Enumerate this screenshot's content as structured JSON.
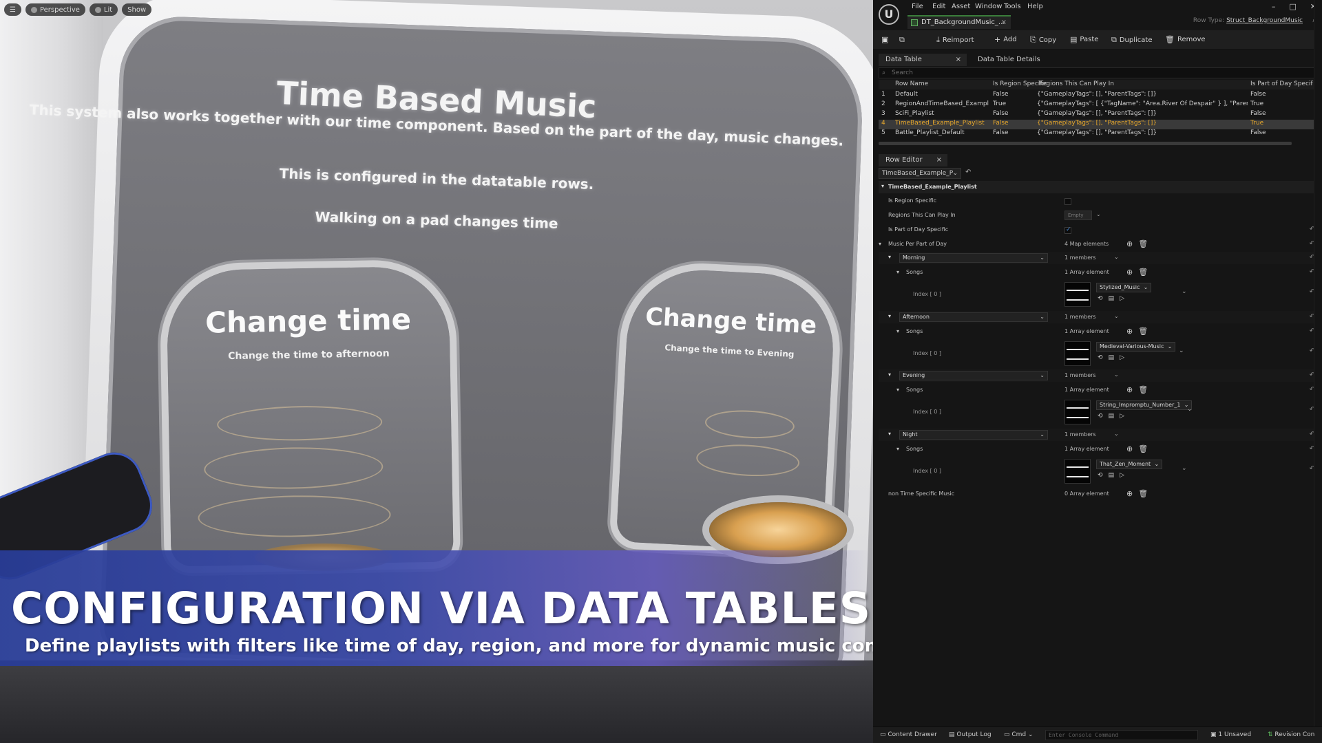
{
  "viewport": {
    "toolbar": {
      "perspective": "Perspective",
      "lit": "Lit",
      "show": "Show"
    },
    "title": "Time Based Music",
    "line1": "This system also works together with our time component. Based on the part of the day, music changes.",
    "line2": "This is configured in the datatable rows.",
    "line3": "Walking on a pad changes time",
    "padA": {
      "title": "Change time",
      "subtitle": "Change the time to afternoon"
    },
    "padB": {
      "title": "Change time",
      "subtitle": "Change the time to Evening"
    }
  },
  "banner": {
    "title": "CONFIGURATION VIA DATA TABLES",
    "subtitle": "Define playlists with filters like time of day, region, and more for dynamic music control"
  },
  "editor": {
    "menu": [
      "File",
      "Edit",
      "Asset",
      "Window",
      "Tools",
      "Help"
    ],
    "logo": "U",
    "window_controls": {
      "minimize": "–",
      "maximize": "□",
      "close": "✕"
    },
    "doc_tab": {
      "label": "DT_BackgroundMusic_...",
      "close": "×"
    },
    "row_type": {
      "label": "Row Type:",
      "value": "Struct_BackgroundMusic"
    },
    "toolbar": {
      "reimport": "Reimport",
      "add": "Add",
      "copy": "Copy",
      "paste": "Paste",
      "duplicate": "Duplicate",
      "remove": "Remove"
    },
    "data_table": {
      "tab": "Data Table",
      "tab_close": "×",
      "details_tab": "Data Table Details",
      "search_placeholder": "Search",
      "columns": [
        "Row Name",
        "Is Region Specific",
        "Regions This Can Play In",
        "Is Part of Day Specif"
      ],
      "rows": [
        {
          "n": "1",
          "name": "Default",
          "region": "False",
          "regions": "{\"GameplayTags\": [], \"ParentTags\": []}",
          "partofday": "False"
        },
        {
          "n": "2",
          "name": "RegionAndTimeBased_Exampl",
          "region": "True",
          "regions": "{\"GameplayTags\": [ {\"TagName\": \"Area.River Of Despair\" } ], \"ParentTags\"",
          "partofday": "True"
        },
        {
          "n": "3",
          "name": "SciFi_Playlist",
          "region": "False",
          "regions": "{\"GameplayTags\": [], \"ParentTags\": []}",
          "partofday": "False"
        },
        {
          "n": "4",
          "name": "TimeBased_Example_Playlist",
          "region": "False",
          "regions": "{\"GameplayTags\": [], \"ParentTags\": []}",
          "partofday": "True"
        },
        {
          "n": "5",
          "name": "Battle_Playlist_Default",
          "region": "False",
          "regions": "{\"GameplayTags\": [], \"ParentTags\": []}",
          "partofday": "False"
        }
      ],
      "selected_row": 4
    },
    "row_editor": {
      "tab": "Row Editor",
      "tab_close": "×",
      "row_select": "TimeBased_Example_P",
      "section": "TimeBased_Example_Playlist",
      "is_region_specific": "Is Region Specific",
      "regions_label": "Regions This Can Play In",
      "regions_value": "Empty",
      "is_part_of_day": "Is Part of Day Specific",
      "music_per_part": "Music Per Part of Day",
      "map_elements": "4 Map elements",
      "songs_label": "Songs",
      "members": "1 members",
      "array_one": "1 Array element",
      "index_label": "Index [ 0 ]",
      "parts": [
        {
          "key": "Morning",
          "song": "Stylized_Music"
        },
        {
          "key": "Afternoon",
          "song": "Medieval-Various-Music"
        },
        {
          "key": "Evening",
          "song": "String_Impromptu_Number_1"
        },
        {
          "key": "Night",
          "song": "That_Zen_Moment"
        }
      ],
      "non_time": "non Time Specific Music",
      "array_zero": "0 Array element"
    },
    "status": {
      "content_drawer": "Content Drawer",
      "output_log": "Output Log",
      "cmd": "Cmd",
      "console_placeholder": "Enter Console Command",
      "unsaved": "1 Unsaved",
      "revision": "Revision Con"
    }
  }
}
